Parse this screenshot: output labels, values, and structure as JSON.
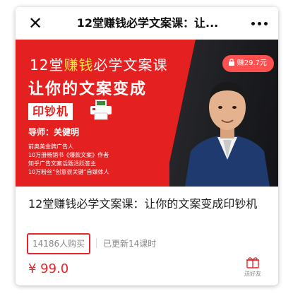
{
  "window": {
    "title": "12堂赚钱必学文案课：让...",
    "close_icon": "close-icon",
    "more_icon": "more-icon"
  },
  "banner": {
    "line1_a": "12堂",
    "line1_highlight": "赚钱",
    "line1_b": "必学文案课",
    "line2": "让你的文案变成",
    "tag": "印钞机",
    "author": "导师：关健明",
    "desc": [
      "前奥美金牌广告人",
      "10万册畅销书《爆款文案》作者",
      "知乎广告文案话题活跃答主",
      "10万粉丝“创意很关键”自媒体人"
    ],
    "earn_badge": "赚29.7元",
    "colors": {
      "banner_red": "#e42020",
      "highlight": "#ffe14a",
      "badge": "#ff4f4f"
    }
  },
  "course": {
    "title": "12堂赚钱必学文案课：让你的文案变成印钞机",
    "sales": "14186人购买",
    "updated": "已更新14课时",
    "price": "¥ 99.0",
    "gift_label": "送好友",
    "colors": {
      "price": "#e8242c",
      "highlight_box": "#e8242c"
    }
  }
}
